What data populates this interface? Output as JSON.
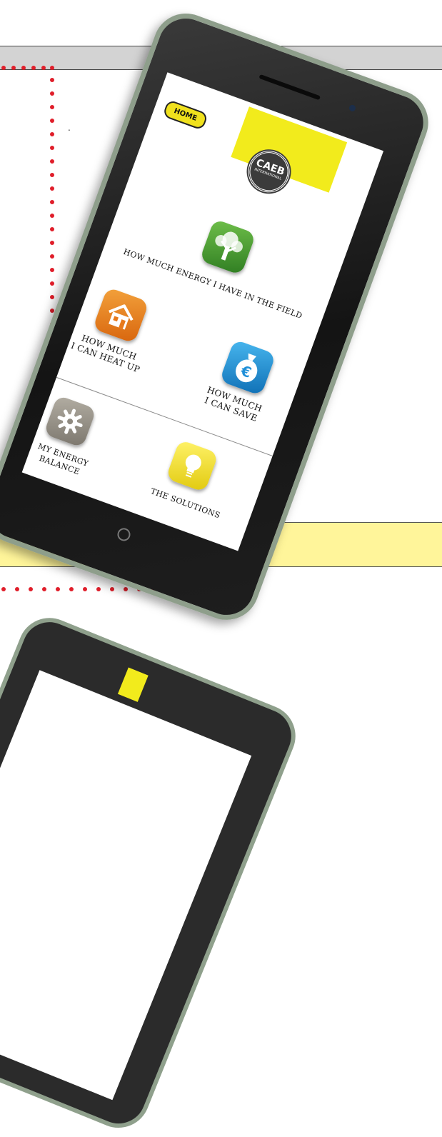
{
  "app": {
    "home_label": "HOME",
    "logo": {
      "main": "CAEB",
      "sub": "INTERNATIONAL"
    }
  },
  "menu": {
    "field_label": "HOW MUCH ENERGY I HAVE IN THE FIELD",
    "heat_label": "HOW MUCH\nI CAN HEAT UP",
    "save_label": "HOW MUCH\nI CAN SAVE",
    "balance_label": "MY ENERGY\nBALANCE",
    "solutions_label": "THE SOLUTIONS"
  },
  "icons": {
    "field": "tree-icon",
    "heat": "house-icon",
    "save": "money-bag-euro-icon",
    "balance": "gear-icon",
    "solutions": "lightbulb-icon"
  },
  "page": {
    "stray_mark": "."
  },
  "colors": {
    "accent_yellow": "#f2eb1c",
    "band_grey": "#d3d3d3",
    "band_yellow": "#fff59a",
    "dot_red": "#e01e2a",
    "tree_green": "#3f9a2c",
    "house_orange": "#e8791a",
    "money_blue": "#1e8fd8",
    "gear_grey": "#8f8a80",
    "bulb_yellow": "#f2e21a"
  }
}
